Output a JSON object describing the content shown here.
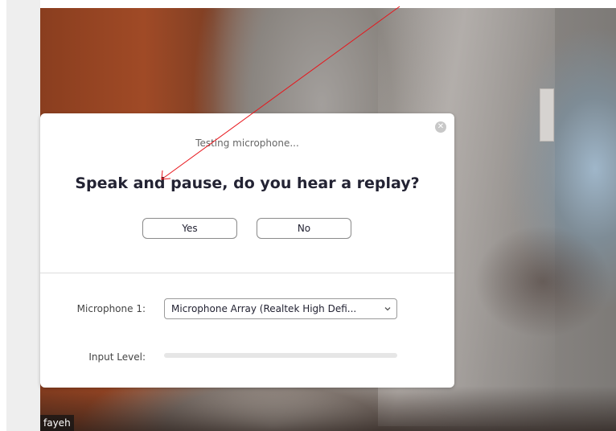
{
  "video": {
    "participant_name": "fayeh"
  },
  "dialog": {
    "status": "Testing microphone...",
    "prompt": "Speak and pause, do you hear a replay?",
    "yes_label": "Yes",
    "no_label": "No",
    "close_icon": "close-icon",
    "microphone_label": "Microphone 1:",
    "microphone_value": "Microphone Array (Realtek High Defi...",
    "input_level_label": "Input Level:",
    "input_level_fraction": 0
  },
  "annotation": {
    "color": "#e8151b"
  }
}
